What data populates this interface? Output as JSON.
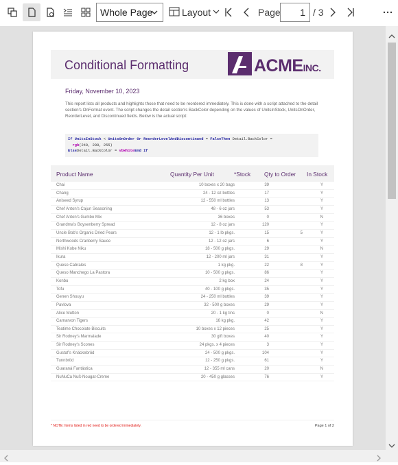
{
  "toolbar": {
    "zoom_value": "Whole Page",
    "layout_label": "Layout",
    "page_label": "Page",
    "page_current": "1",
    "page_total": "/ 3"
  },
  "report": {
    "title": "Conditional Formatting",
    "logo_text": "ACME",
    "logo_suffix": "INC.",
    "date": "Friday, November 10, 2023",
    "description": "This report lists all products and highlights those that need to be reordered immediately. This is done with a script attached to the detail section's OnFormat event. The script changes the detail section's BackColor depending on the values of UnitsInStock, UnitsOnOrder, ReorderLevel, and Discontinued fields. Below is the actual script:",
    "code_line1_a": "If",
    "code_line1_b": "UnitsInStock",
    "code_line1_c": "<",
    "code_line1_d": "UnitsOnOrder",
    "code_line1_e": "Or",
    "code_line1_f": "ReorderLevelAndDiscontinued",
    "code_line1_g": "=",
    "code_line1_h": "False",
    "code_line1_i": "Then",
    "code_line1_j": "Detail.BackColor =",
    "code_line2_a": "rgb",
    "code_line2_b": "(240, 200, 255)",
    "code_line3_a": "Else",
    "code_line3_b": "Detail.BackColor =",
    "code_line3_c": "vbWhite",
    "code_line3_d": "End",
    "code_line3_e": "If",
    "columns": [
      "Product Name",
      "Quantity Per Unit",
      "*Stock",
      "Qty to Order",
      "In Stock"
    ],
    "rows": [
      [
        "Chai",
        "10 boxes x 20 bags",
        "39",
        "",
        "Y"
      ],
      [
        "Chang",
        "24 - 12 oz bottles",
        "17",
        "",
        "Y"
      ],
      [
        "Aniseed Syrup",
        "12 - 550 ml bottles",
        "13",
        "",
        "Y"
      ],
      [
        "Chef Anton's Cajun Seasoning",
        "48 - 6 oz jars",
        "53",
        "",
        "Y"
      ],
      [
        "Chef Anton's Gumbo Mix",
        "36 boxes",
        "0",
        "",
        "N"
      ],
      [
        "Grandma's Boysenberry Spread",
        "12 - 8 oz jars",
        "120",
        "",
        "Y"
      ],
      [
        "Uncle Bob's Organic Dried Pears",
        "12 - 1 lb pkgs.",
        "15",
        "5",
        "Y"
      ],
      [
        "Northwoods Cranberry Sauce",
        "12 - 12 oz jars",
        "6",
        "",
        "Y"
      ],
      [
        "Mishi Kobe Niku",
        "18 - 500 g pkgs.",
        "29",
        "",
        "N"
      ],
      [
        "Ikura",
        "12 - 200 ml jars",
        "31",
        "",
        "Y"
      ],
      [
        "Queso Cabrales",
        "1 kg pkg.",
        "22",
        "8",
        "Y"
      ],
      [
        "Queso Manchego La Pastora",
        "10 - 500 g pkgs.",
        "86",
        "",
        "Y"
      ],
      [
        "Konbu",
        "2 kg box",
        "24",
        "",
        "Y"
      ],
      [
        "Tofu",
        "40 - 100 g pkgs.",
        "35",
        "",
        "Y"
      ],
      [
        "Genen Shouyu",
        "24 - 250 ml bottles",
        "39",
        "",
        "Y"
      ],
      [
        "Pavlova",
        "32 - 500 g boxes",
        "29",
        "",
        "Y"
      ],
      [
        "Alice Mutton",
        "20 - 1 kg tins",
        "0",
        "",
        "N"
      ],
      [
        "Carnarvon Tigers",
        "16 kg pkg.",
        "42",
        "",
        "Y"
      ],
      [
        "Teatime Chocolate Biscuits",
        "10 boxes x 12 pieces",
        "25",
        "",
        "Y"
      ],
      [
        "Sir Rodney's Marmalade",
        "30 gift boxes",
        "40",
        "",
        "Y"
      ],
      [
        "Sir Rodney's Scones",
        "24 pkgs. x 4 pieces",
        "3",
        "",
        "Y"
      ],
      [
        "Gustaf's Knäckebröd",
        "24 - 500 g pkgs.",
        "104",
        "",
        "Y"
      ],
      [
        "Tunnbröd",
        "12 - 250 g pkgs.",
        "61",
        "",
        "Y"
      ],
      [
        "Guaraná Fantástica",
        "12 - 355 ml cans",
        "20",
        "",
        "N"
      ],
      [
        "NuNuCa Nuß-Nougat-Creme",
        "20 - 450 g glasses",
        "76",
        "",
        "Y"
      ]
    ],
    "footer_note": "* NOTE: Items listed in red need to be ordered immediately.",
    "footer_page": "Page 1 of 2"
  },
  "colors": {
    "accent": "#5b2d6e",
    "note": "#e0140f"
  }
}
